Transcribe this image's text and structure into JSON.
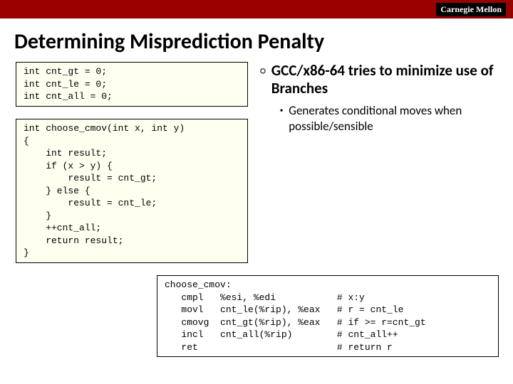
{
  "brand": "Carnegie Mellon",
  "title": "Determining Misprediction Penalty",
  "code_globals": "int cnt_gt = 0;\nint cnt_le = 0;\nint cnt_all = 0;",
  "code_func": "int choose_cmov(int x, int y)\n{\n    int result;\n    if (x > y) {\n        result = cnt_gt;\n    } else {\n        result = cnt_le;\n    }\n    ++cnt_all;\n    return result;\n}",
  "code_asm": "choose_cmov:\n   cmpl   %esi, %edi           # x:y\n   movl   cnt_le(%rip), %eax   # r = cnt_le\n   cmovg  cnt_gt(%rip), %eax   # if >= r=cnt_gt\n   incl   cnt_all(%rip)        # cnt_all++\n   ret                         # return r",
  "bullets": {
    "main": "GCC/x86-64 tries to minimize use of Branches",
    "sub": "Generates conditional moves when possible/sensible"
  }
}
